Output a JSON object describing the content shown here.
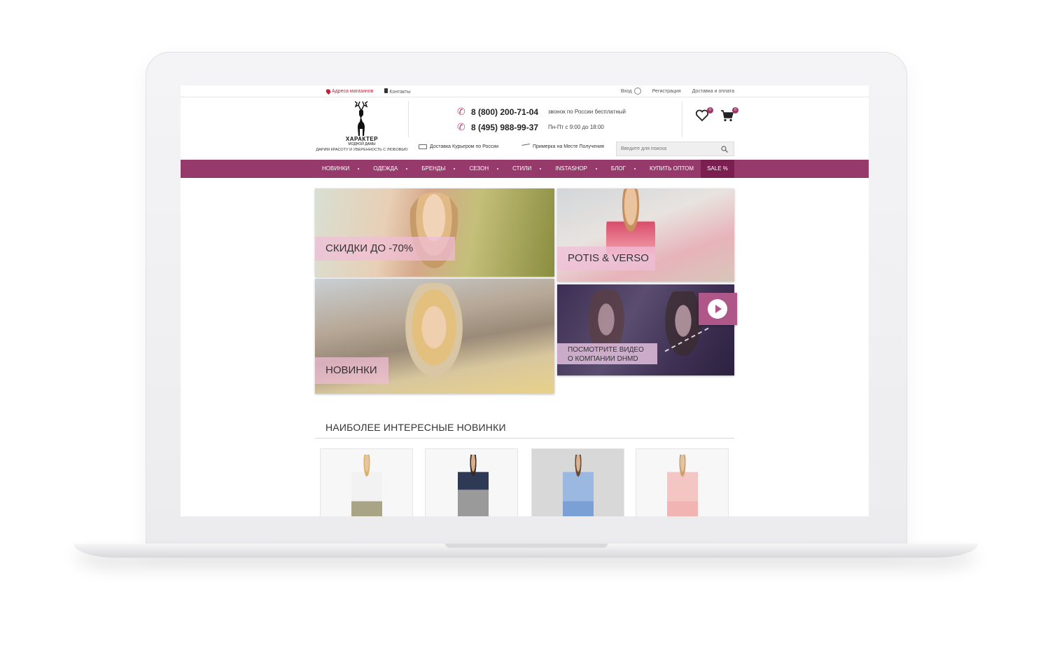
{
  "topbar": {
    "stores_label": "Адреса магазинов",
    "contacts_label": "Контакты",
    "login_label": "Вход",
    "register_label": "Регистрация",
    "delivery_label": "Доставка и оплата"
  },
  "logo": {
    "name": "ХАРАКТЕР",
    "sub": "МОДНОЙ ДАМЫ",
    "tagline": "ДАРИМ КРАСОТУ И УВЕРЕННОСТЬ С ЛЮБОВЬЮ"
  },
  "phones": [
    {
      "number": "8 (800) 200-71-04",
      "note": "звонок по России бесплатный"
    },
    {
      "number": "8 (495) 988-99-37",
      "note": "Пн-Пт с 9:00 до 18:00"
    }
  ],
  "header_icons": {
    "wishlist_count": "0",
    "cart_count": "0"
  },
  "services": {
    "courier": "Доставка Курьером по России",
    "fitting": "Примерка на Месте Получения"
  },
  "search": {
    "placeholder": "Введите для поиска"
  },
  "nav": {
    "items": [
      "НОВИНКИ",
      "ОДЕЖДА",
      "БРЕНДЫ",
      "СЕЗОН",
      "СТИЛИ",
      "INSTASHOP",
      "БЛОГ",
      "КУПИТЬ ОПТОМ"
    ],
    "sale": "SALE %"
  },
  "banners": {
    "discounts": "СКИДКИ ДО -70%",
    "brand": "POTIS & VERSO",
    "new_arrivals": "НОВИНКИ",
    "video_line1": "ПОСМОТРИТЕ ВИДЕО",
    "video_line2": "О КОМПАНИИ DHMD"
  },
  "section": {
    "title": "НАИБОЛЕЕ ИНТЕРЕСНЫЕ НОВИНКИ"
  },
  "colors": {
    "brand_purple": "#96396b",
    "sale_bg": "#7a1f50",
    "accent_red": "#c0233b"
  }
}
